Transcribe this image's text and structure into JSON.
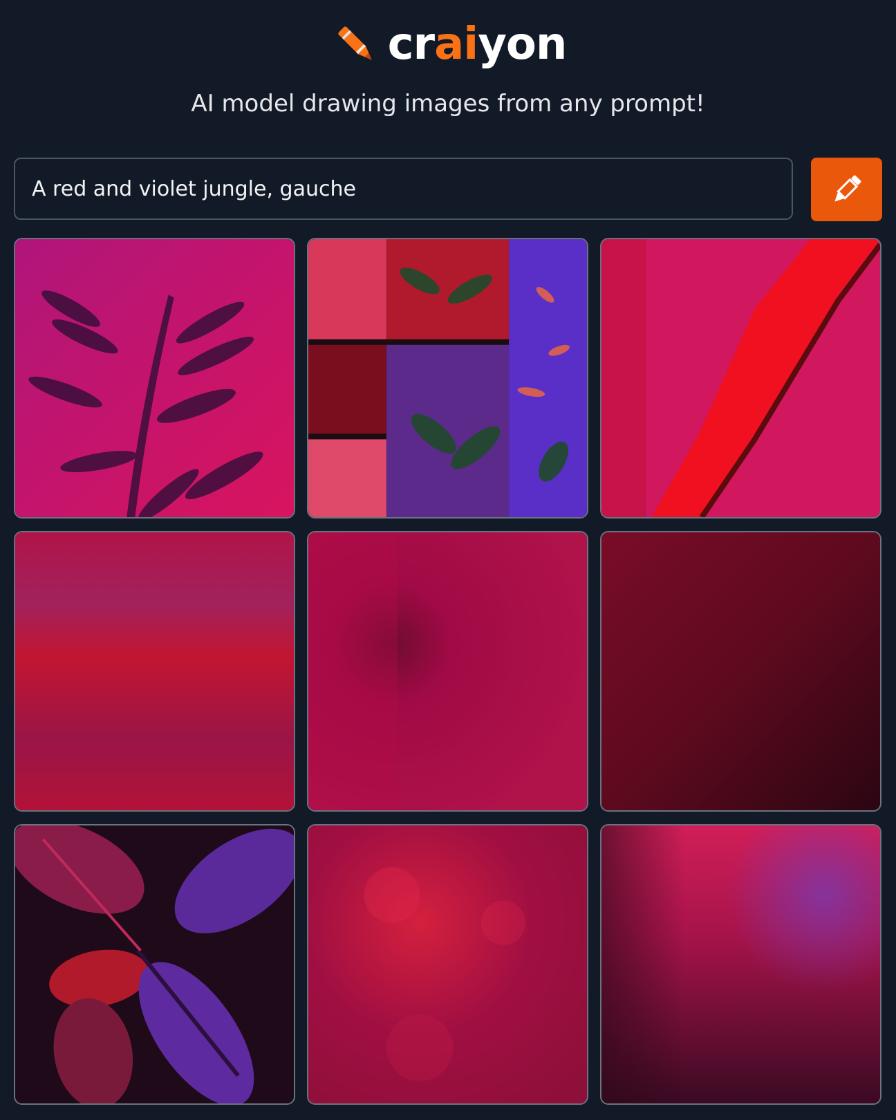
{
  "header": {
    "logo_prefix": "cr",
    "logo_accent": "ai",
    "logo_suffix": "yon",
    "tagline": "AI model drawing images from any prompt!"
  },
  "search": {
    "value": "A red and violet jungle, gauche"
  },
  "draw_button": {
    "icon": "pencil-icon"
  },
  "colors": {
    "background": "#131a27",
    "accent": "#f97316",
    "button": "#ea580c",
    "tile_border": "#6b7280",
    "input_border": "#4b5563"
  },
  "results": {
    "image_count": 9
  }
}
